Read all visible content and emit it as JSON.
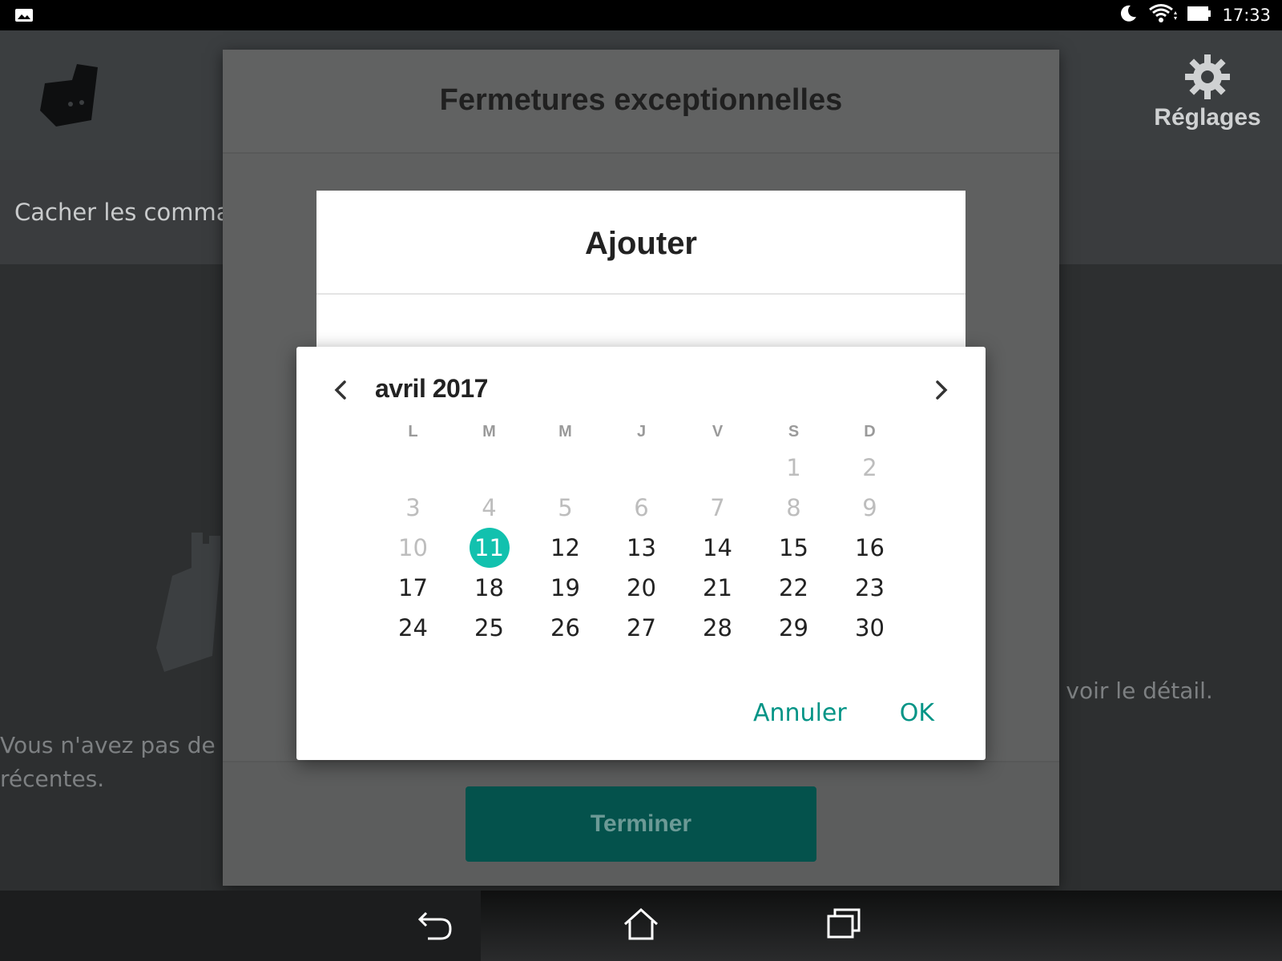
{
  "status_bar": {
    "time": "17:33"
  },
  "app": {
    "settings_label": "Réglages",
    "hide_orders_text": "Cacher les comma",
    "empty_line1": "Vous n'avez pas de c",
    "empty_line2": "récentes.",
    "detail_text": "r voir le détail."
  },
  "outer_dialog": {
    "title": "Fermetures exceptionnelles",
    "done_label": "Terminer"
  },
  "inner_dialog": {
    "title": "Ajouter"
  },
  "date_picker": {
    "month_label": "avril 2017",
    "weekdays": [
      "L",
      "M",
      "M",
      "J",
      "V",
      "S",
      "D"
    ],
    "leading_blanks": 5,
    "days": [
      "1",
      "2",
      "3",
      "4",
      "5",
      "6",
      "7",
      "8",
      "9",
      "10",
      "11",
      "12",
      "13",
      "14",
      "15",
      "16",
      "17",
      "18",
      "19",
      "20",
      "21",
      "22",
      "23",
      "24",
      "25",
      "26",
      "27",
      "28",
      "29",
      "30"
    ],
    "disabled_before": 11,
    "selected_day": "11",
    "cancel_label": "Annuler",
    "ok_label": "OK",
    "accent_color": "#12c1ae",
    "button_color": "#049486"
  }
}
